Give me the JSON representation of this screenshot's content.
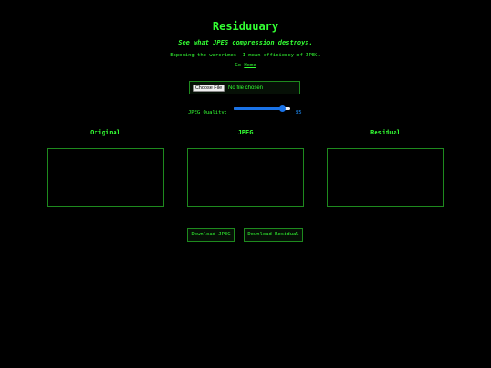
{
  "header": {
    "title": "Residuuary",
    "subtitle": "See what JPEG compression destroys.",
    "tagline": "Exposing the warcrimes- I mean efficiency of JPEG.",
    "nav_prefix": "Go ",
    "nav_link": "Home"
  },
  "file_input": {
    "button_label": "Choose File",
    "status": "No file chosen"
  },
  "quality": {
    "label": "JPEG Quality:",
    "value": 85,
    "value_display": "85",
    "min": 1,
    "max": 100
  },
  "panels": [
    {
      "label": "Original"
    },
    {
      "label": "JPEG"
    },
    {
      "label": "Residual"
    }
  ],
  "actions": {
    "download_jpeg": "Download JPEG",
    "download_residual": "Download Residual"
  },
  "colors": {
    "background": "#000000",
    "text": "#33ff33",
    "border": "#1e8a1e",
    "accent": "#1a73e8",
    "value": "#1e90ff",
    "divider": "#bfbfbf"
  }
}
